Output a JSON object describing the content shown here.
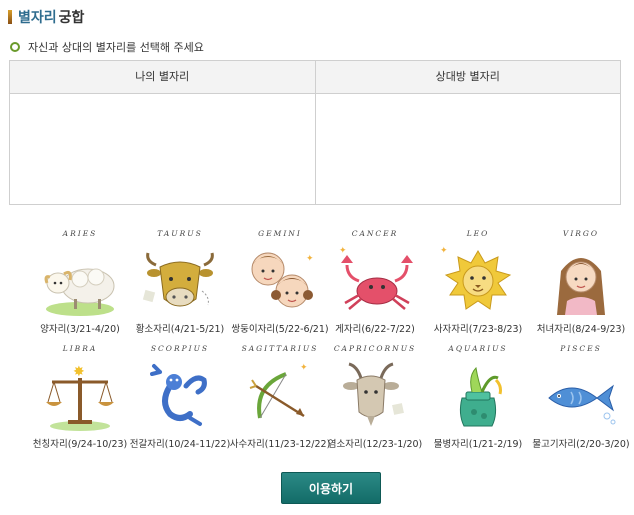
{
  "header": {
    "title_part1": "별자리",
    "title_part2": "궁합"
  },
  "instruction": "자신과 상대의 별자리를 선택해 주세요",
  "selection": {
    "my_label": "나의 별자리",
    "partner_label": "상대방 별자리"
  },
  "zodiacs": [
    {
      "en": "ARIES",
      "ko": "양자리(3/21-4/20)",
      "icon": "ram-icon"
    },
    {
      "en": "TAURUS",
      "ko": "황소자리(4/21-5/21)",
      "icon": "bull-icon"
    },
    {
      "en": "GEMINI",
      "ko": "쌍둥이자리(5/22-6/21)",
      "icon": "twins-icon"
    },
    {
      "en": "CANCER",
      "ko": "게자리(6/22-7/22)",
      "icon": "crab-icon"
    },
    {
      "en": "LEO",
      "ko": "사자자리(7/23-8/23)",
      "icon": "lion-icon"
    },
    {
      "en": "VIRGO",
      "ko": "처녀자리(8/24-9/23)",
      "icon": "maiden-icon"
    },
    {
      "en": "LIBRA",
      "ko": "천칭자리(9/24-10/23)",
      "icon": "scales-icon"
    },
    {
      "en": "SCORPIUS",
      "ko": "전갈자리(10/24-11/22)",
      "icon": "scorpion-icon"
    },
    {
      "en": "SAGITTARIUS",
      "ko": "사수자리(11/23-12/22)",
      "icon": "bow-arrow-icon"
    },
    {
      "en": "CAPRICORNUS",
      "ko": "염소자리(12/23-1/20)",
      "icon": "goat-icon"
    },
    {
      "en": "AQUARIUS",
      "ko": "물병자리(1/21-2/19)",
      "icon": "water-jar-icon"
    },
    {
      "en": "PISCES",
      "ko": "물고기자리(2/20-3/20)",
      "icon": "fish-icon"
    }
  ],
  "button": {
    "label": "이용하기"
  },
  "colors": {
    "accent": "#2e6c8e",
    "button": "#1f7b77",
    "bullet": "#6a9a2b"
  }
}
